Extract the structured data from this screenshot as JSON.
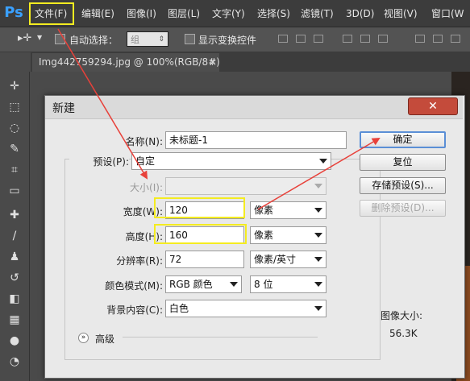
{
  "app": {
    "logo": "Ps"
  },
  "menu": [
    "文件(F)",
    "编辑(E)",
    "图像(I)",
    "图层(L)",
    "文字(Y)",
    "选择(S)",
    "滤镜(T)",
    "3D(D)",
    "视图(V)",
    "窗口(W"
  ],
  "options_bar": {
    "tool_icon": "move-tool-icon",
    "auto_select_label": "自动选择：",
    "auto_select_target": "组",
    "show_transform_label": "显示变换控件"
  },
  "document": {
    "tab_title": "Img442759294.jpg @ 100%(RGB/8#)",
    "close_glyph": "×"
  },
  "toolbox": [
    "move-tool-icon",
    "marquee-tool-icon",
    "lasso-tool-icon",
    "quick-select-tool-icon",
    "crop-tool-icon",
    "ruler-tool-icon",
    "healing-brush-tool-icon",
    "brush-tool-icon",
    "stamp-tool-icon",
    "history-brush-tool-icon",
    "eraser-tool-icon",
    "gradient-tool-icon",
    "blur-tool-icon",
    "dodge-tool-icon"
  ],
  "dialog": {
    "title": "新建",
    "close_glyph": "✕",
    "name_label": "名称(N):",
    "name_value": "未标题-1",
    "preset_label": "预设(P):",
    "preset_value": "自定",
    "size_label": "大小(I):",
    "size_value": "",
    "width_label": "宽度(W):",
    "width_value": "120",
    "width_unit": "像素",
    "height_label": "高度(H):",
    "height_value": "160",
    "height_unit": "像素",
    "resolution_label": "分辨率(R):",
    "resolution_value": "72",
    "resolution_unit": "像素/英寸",
    "color_mode_label": "颜色模式(M):",
    "color_mode_value": "RGB 颜色",
    "bit_depth_value": "8 位",
    "background_label": "背景内容(C):",
    "background_value": "白色",
    "advanced_label": "高级",
    "buttons": {
      "ok": "确定",
      "reset": "复位",
      "save_preset": "存储预设(S)...",
      "delete_preset": "删除预设(D)..."
    },
    "image_size_label": "图像大小:",
    "image_size_value": "56.3K"
  },
  "annotation_color": "#f4ec20",
  "arrow_color": "#e8413a"
}
